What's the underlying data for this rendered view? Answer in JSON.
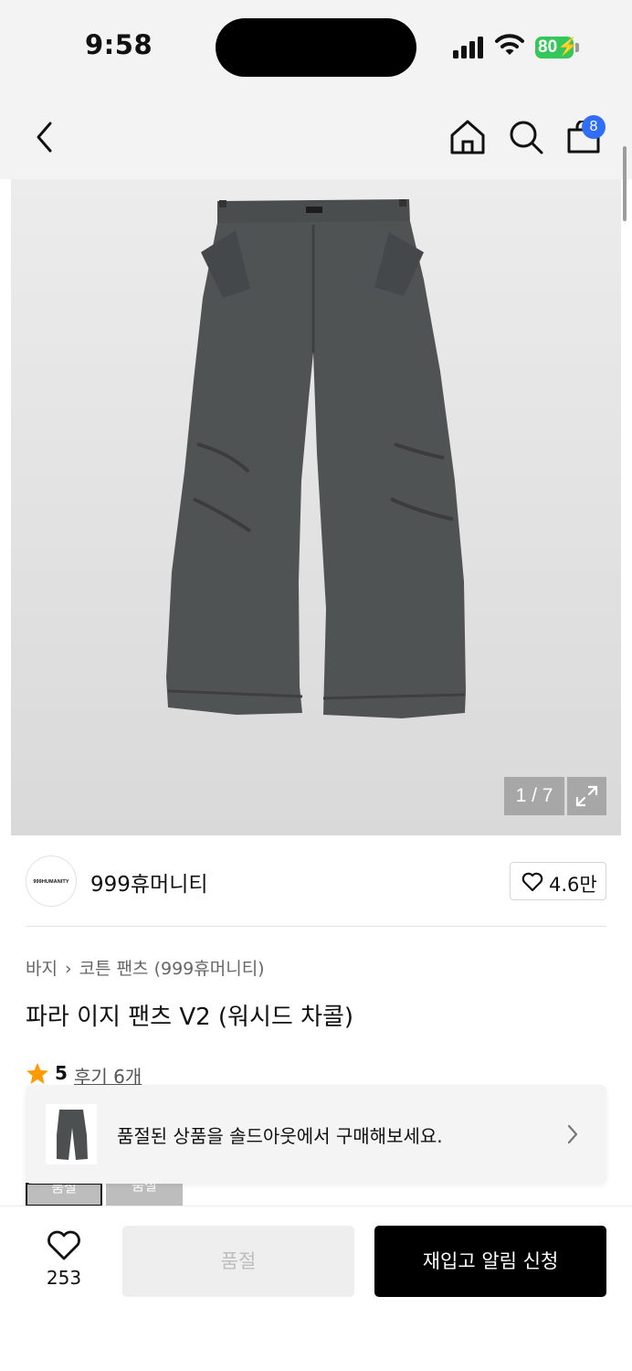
{
  "status": {
    "time": "9:58",
    "battery": "80"
  },
  "header": {
    "cart_count": "8"
  },
  "gallery": {
    "counter": "1 / 7"
  },
  "brand": {
    "logo_text": "999HUMANITY",
    "name": "999휴머니티",
    "likes": "4.6만"
  },
  "breadcrumb": {
    "level1": "바지",
    "level2": "코튼 팬츠 (999휴머니티)"
  },
  "product": {
    "title": "파라 이지 팬츠 V2 (워시드 차콜)",
    "rating": "5",
    "reviews": "후기 6개"
  },
  "banner": {
    "text": "품절된 상품을 솔드아웃에서 구매해보세요."
  },
  "options": [
    {
      "label": "품절"
    },
    {
      "label": "품절"
    }
  ],
  "bottom": {
    "wish_count": "253",
    "soldout_label": "품절",
    "restock_label": "재입고 알림 신청"
  },
  "colors": {
    "badge": "#2f6ef5",
    "star": "#ff9b00",
    "battery": "#34c759",
    "primary": "#000000"
  },
  "icons": [
    "back-icon",
    "home-icon",
    "search-icon",
    "bag-icon",
    "expand-icon",
    "heart-icon",
    "star-icon",
    "chevron-right-icon"
  ]
}
